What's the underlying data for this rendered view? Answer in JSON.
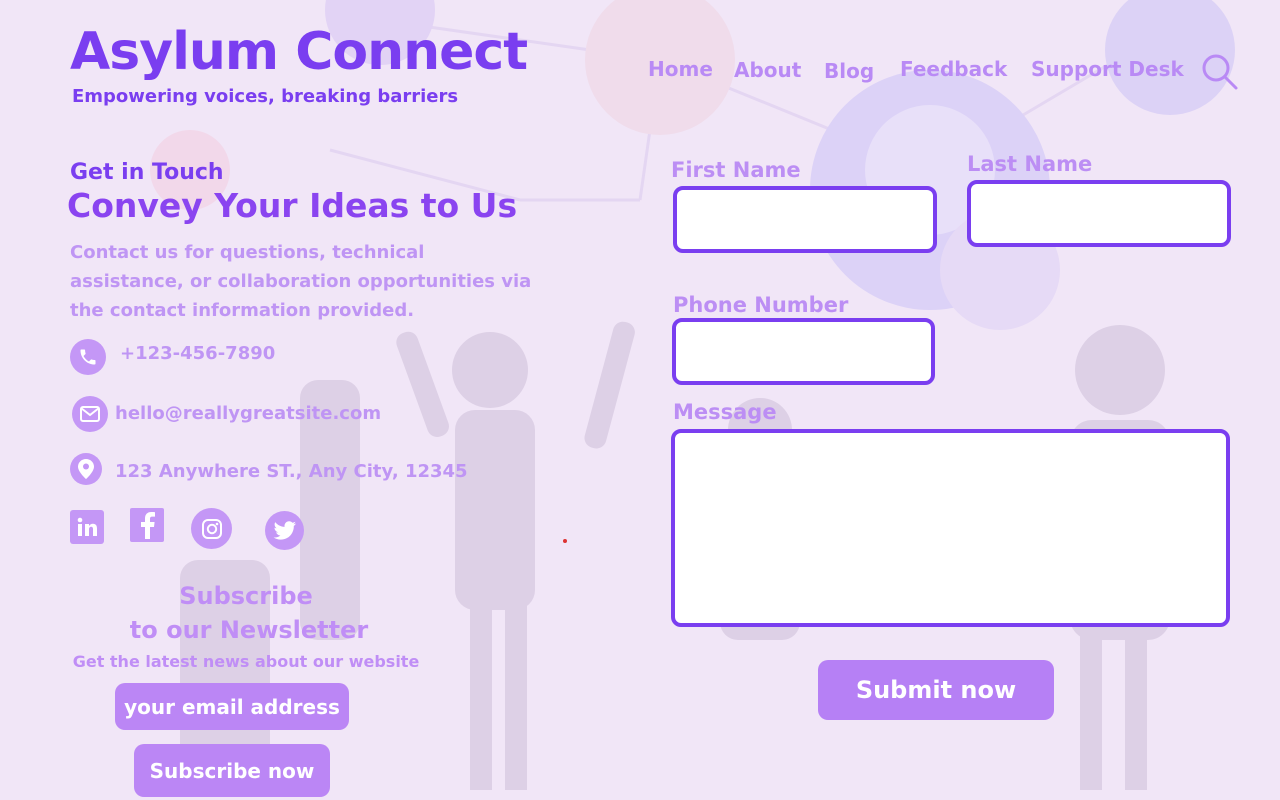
{
  "brand": {
    "title": "Asylum Connect",
    "tagline": "Empowering voices, breaking barriers"
  },
  "nav": {
    "items": [
      "Home",
      "About",
      "Blog",
      "Feedback",
      "Support Desk"
    ],
    "search_icon": "search-icon"
  },
  "contact": {
    "kicker": "Get in Touch",
    "heading": "Convey Your Ideas to Us",
    "description": "Contact us for questions, technical assistance, or collaboration opportunities via the contact information provided.",
    "phone": "+123-456-7890",
    "email": "hello@reallygreatsite.com",
    "address": "123 Anywhere ST., Any City, 12345"
  },
  "social": [
    "linkedin-icon",
    "facebook-icon",
    "instagram-icon",
    "twitter-icon"
  ],
  "newsletter": {
    "heading_line1": "Subscribe",
    "heading_line2": "to our Newsletter",
    "subtext": "Get the latest news about our website",
    "email_placeholder": "your email address",
    "button": "Subscribe now"
  },
  "form": {
    "first_name_label": "First Name",
    "last_name_label": "Last Name",
    "phone_label": "Phone Number",
    "message_label": "Message",
    "submit_label": "Submit now"
  },
  "colors": {
    "accent": "#7a3ef0",
    "soft": "#bc8ef4",
    "background": "#f1e6f7"
  }
}
